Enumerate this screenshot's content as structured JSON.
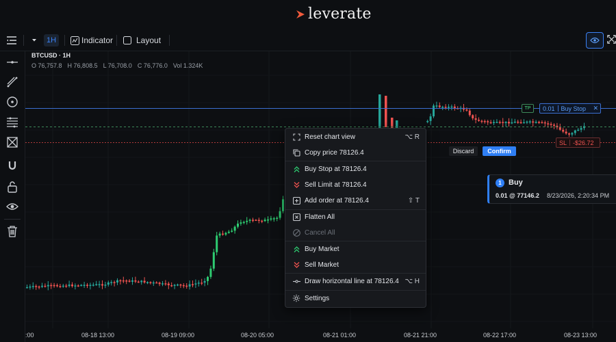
{
  "brand": {
    "name": "leverate",
    "accent": "#f05a3c"
  },
  "toolbar": {
    "timeframe": "1H",
    "indicator_label": "Indicator",
    "layout_label": "Layout"
  },
  "sidebar": {
    "icons": [
      "crosshair-icon",
      "trendline-icon",
      "circle-icon",
      "fib-icon",
      "pattern-icon",
      "magnet-icon",
      "lock-icon",
      "eye-icon",
      "trash-icon"
    ]
  },
  "chart": {
    "symbol": "BTCUSD · 1H",
    "ohlc": {
      "open": "O 76,757.8",
      "high": "H 76,808.5",
      "low": "L 76,708.0",
      "close": "C 76,776.0",
      "vol": "Vol 1.324K"
    },
    "xaxis_labels": [
      ":00",
      "08-18 13:00",
      "08-19 09:00",
      "08-20 05:00",
      "08-21 01:00",
      "08-21 21:00",
      "08-22 17:00",
      "08-23 13:00"
    ],
    "colors": {
      "up": "#26a69a",
      "up_bright": "#2ecc71",
      "down": "#ef5350",
      "tp_line": "#3b6fd1",
      "sl_line": "#ef5350",
      "current_line": "#3d8a5a"
    }
  },
  "chart_data": {
    "type": "candlestick",
    "title": "BTCUSD · 1H",
    "x_ticks": [
      ":00",
      "08-18 13:00",
      "08-19 09:00",
      "08-20 05:00",
      "08-21 01:00",
      "08-21 21:00",
      "08-22 17:00",
      "08-23 13:00"
    ]
  },
  "context_menu": {
    "items": [
      {
        "label": "Reset chart view",
        "shortcut": "⌥ R",
        "icon": "reset-view-icon",
        "disabled": false
      },
      {
        "label": "Copy price 78126.4",
        "shortcut": "",
        "icon": "copy-icon",
        "disabled": false
      },
      {
        "label": "Buy Stop at 78126.4",
        "shortcut": "",
        "icon": "buy-stop-icon",
        "disabled": false
      },
      {
        "label": "Sell Limit at 78126.4",
        "shortcut": "",
        "icon": "sell-limit-icon",
        "disabled": false
      },
      {
        "label": "Add order at 78126.4",
        "shortcut": "⇧ T",
        "icon": "add-order-icon",
        "disabled": false
      },
      {
        "label": "Flatten All",
        "shortcut": "",
        "icon": "flatten-icon",
        "disabled": false
      },
      {
        "label": "Cancel All",
        "shortcut": "",
        "icon": "cancel-icon",
        "disabled": true
      },
      {
        "label": "Buy Market",
        "shortcut": "",
        "icon": "buy-market-icon",
        "disabled": false
      },
      {
        "label": "Sell Market",
        "shortcut": "",
        "icon": "sell-market-icon",
        "disabled": false
      },
      {
        "label": "Draw horizontal line at 78126.4",
        "shortcut": "⌥ H",
        "icon": "horizontal-line-icon",
        "disabled": false
      },
      {
        "label": "Settings",
        "shortcut": "",
        "icon": "settings-icon",
        "disabled": false
      }
    ]
  },
  "pending_order": {
    "discard_label": "Discard",
    "confirm_label": "Confirm",
    "tp_label": "TP",
    "qty": "0.01",
    "type_label": "Buy Stop",
    "close_glyph": "✕",
    "sl_label": "SL",
    "sl_value": "-$26.72"
  },
  "order_panel": {
    "index": "1",
    "side": "Buy",
    "amount": "0.01 @ 77146.2",
    "time": "8/23/2026, 2:20:34 PM"
  }
}
